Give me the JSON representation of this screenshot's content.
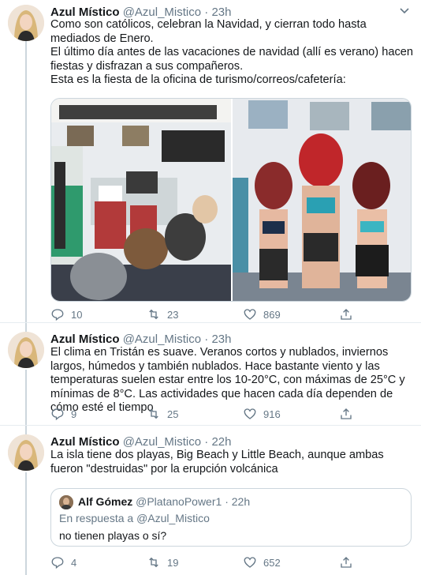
{
  "tweets": [
    {
      "name": "Azul Místico",
      "handle": "@Azul_Mistico",
      "dot": "·",
      "time": "23h",
      "paragraphs": [
        "Como son católicos, celebran la Navidad, y cierran todo hasta mediados de Enero.",
        "El último día antes de las vacaciones de navidad (allí es verano) hacen fiestas y disfrazan a sus compañeros.",
        "Esta es la fiesta de la oficina de turismo/correos/cafetería:"
      ],
      "replies": "10",
      "retweets": "23",
      "likes": "869"
    },
    {
      "name": "Azul Místico",
      "handle": "@Azul_Mistico",
      "dot": "·",
      "time": "23h",
      "paragraphs": [
        "El clima en Tristán es suave. Veranos cortos y nublados, inviernos largos, húmedos y también nublados. Hace bastante viento y las temperaturas suelen estar entre los 10-20°C, con máximas de 25°C y mínimas de 8°C. Las actividades que hacen cada día dependen de cómo esté el tiempo"
      ],
      "replies": "9",
      "retweets": "25",
      "likes": "916"
    },
    {
      "name": "Azul Místico",
      "handle": "@Azul_Mistico",
      "dot": "·",
      "time": "22h",
      "paragraphs": [
        "La isla tiene dos playas, Big Beach y Little Beach, aunque ambas fueron \"destruidas\" por la erupción volcánica"
      ],
      "replies": "4",
      "retweets": "19",
      "likes": "652"
    }
  ],
  "quote": {
    "name": "Alf Gómez",
    "handle": "@PlatanoPower1",
    "dot": "·",
    "time": "22h",
    "reply_prefix": "En respuesta a",
    "reply_to": "@Azul_Mistico",
    "text": "no tienen playas o sí?"
  },
  "colors": {
    "text": "#14171a",
    "secondary": "#657786",
    "border": "#ccd6dd"
  },
  "icons": [
    "avatar",
    "chevron-down-icon",
    "reply-icon",
    "retweet-icon",
    "like-icon",
    "share-icon"
  ]
}
